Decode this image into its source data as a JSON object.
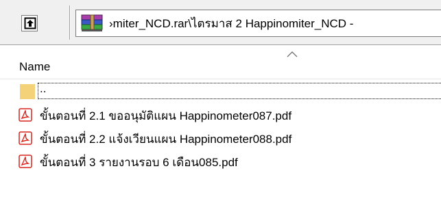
{
  "toolbar": {
    "up_icon": "up-arrow-icon",
    "archive_icon": "winrar-archive-icon",
    "path": "›miter_NCD.rar\\ไตรมาส 2 Happinomiter_NCD -"
  },
  "list": {
    "column_header": "Name",
    "sort_icon": "sort-ascending-icon",
    "parent_label": "..",
    "items": [
      {
        "name": "ขั้นตอนที่ 2.1  ขออนุมัติแผน Happinometer087.pdf",
        "icon": "pdf-file-icon"
      },
      {
        "name": "ขั้นตอนที่ 2.2 แจ้งเวียนแผน Happinometer088.pdf",
        "icon": "pdf-file-icon"
      },
      {
        "name": "ขั้นตอนที่ 3 รายงานรอบ 6 เดือน085.pdf",
        "icon": "pdf-file-icon"
      }
    ]
  },
  "colors": {
    "toolbar_bg": "#f0f0f0",
    "folder": "#f3d27a",
    "pdf_red": "#d9241c"
  }
}
